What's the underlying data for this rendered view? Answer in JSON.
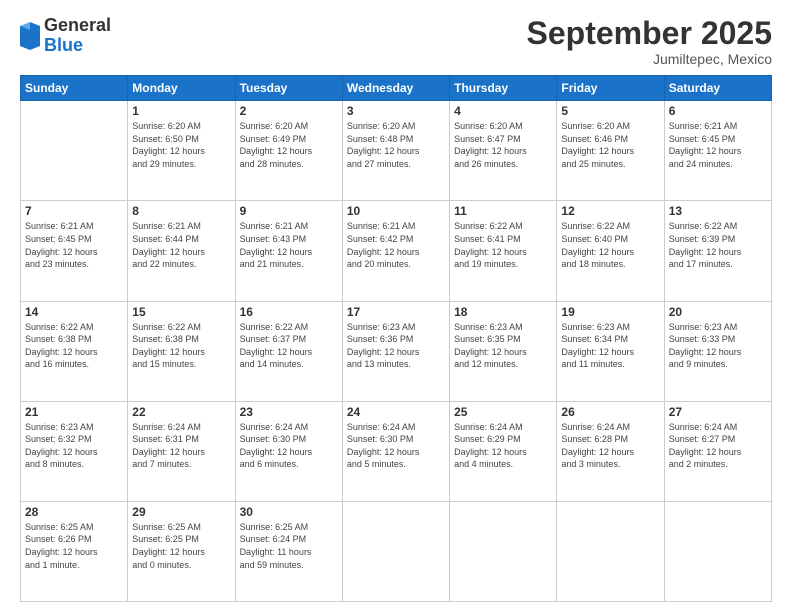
{
  "logo": {
    "general": "General",
    "blue": "Blue"
  },
  "header": {
    "month": "September 2025",
    "location": "Jumiltepec, Mexico"
  },
  "weekdays": [
    "Sunday",
    "Monday",
    "Tuesday",
    "Wednesday",
    "Thursday",
    "Friday",
    "Saturday"
  ],
  "weeks": [
    [
      {
        "day": "",
        "info": ""
      },
      {
        "day": "1",
        "info": "Sunrise: 6:20 AM\nSunset: 6:50 PM\nDaylight: 12 hours\nand 29 minutes."
      },
      {
        "day": "2",
        "info": "Sunrise: 6:20 AM\nSunset: 6:49 PM\nDaylight: 12 hours\nand 28 minutes."
      },
      {
        "day": "3",
        "info": "Sunrise: 6:20 AM\nSunset: 6:48 PM\nDaylight: 12 hours\nand 27 minutes."
      },
      {
        "day": "4",
        "info": "Sunrise: 6:20 AM\nSunset: 6:47 PM\nDaylight: 12 hours\nand 26 minutes."
      },
      {
        "day": "5",
        "info": "Sunrise: 6:20 AM\nSunset: 6:46 PM\nDaylight: 12 hours\nand 25 minutes."
      },
      {
        "day": "6",
        "info": "Sunrise: 6:21 AM\nSunset: 6:45 PM\nDaylight: 12 hours\nand 24 minutes."
      }
    ],
    [
      {
        "day": "7",
        "info": "Sunrise: 6:21 AM\nSunset: 6:45 PM\nDaylight: 12 hours\nand 23 minutes."
      },
      {
        "day": "8",
        "info": "Sunrise: 6:21 AM\nSunset: 6:44 PM\nDaylight: 12 hours\nand 22 minutes."
      },
      {
        "day": "9",
        "info": "Sunrise: 6:21 AM\nSunset: 6:43 PM\nDaylight: 12 hours\nand 21 minutes."
      },
      {
        "day": "10",
        "info": "Sunrise: 6:21 AM\nSunset: 6:42 PM\nDaylight: 12 hours\nand 20 minutes."
      },
      {
        "day": "11",
        "info": "Sunrise: 6:22 AM\nSunset: 6:41 PM\nDaylight: 12 hours\nand 19 minutes."
      },
      {
        "day": "12",
        "info": "Sunrise: 6:22 AM\nSunset: 6:40 PM\nDaylight: 12 hours\nand 18 minutes."
      },
      {
        "day": "13",
        "info": "Sunrise: 6:22 AM\nSunset: 6:39 PM\nDaylight: 12 hours\nand 17 minutes."
      }
    ],
    [
      {
        "day": "14",
        "info": "Sunrise: 6:22 AM\nSunset: 6:38 PM\nDaylight: 12 hours\nand 16 minutes."
      },
      {
        "day": "15",
        "info": "Sunrise: 6:22 AM\nSunset: 6:38 PM\nDaylight: 12 hours\nand 15 minutes."
      },
      {
        "day": "16",
        "info": "Sunrise: 6:22 AM\nSunset: 6:37 PM\nDaylight: 12 hours\nand 14 minutes."
      },
      {
        "day": "17",
        "info": "Sunrise: 6:23 AM\nSunset: 6:36 PM\nDaylight: 12 hours\nand 13 minutes."
      },
      {
        "day": "18",
        "info": "Sunrise: 6:23 AM\nSunset: 6:35 PM\nDaylight: 12 hours\nand 12 minutes."
      },
      {
        "day": "19",
        "info": "Sunrise: 6:23 AM\nSunset: 6:34 PM\nDaylight: 12 hours\nand 11 minutes."
      },
      {
        "day": "20",
        "info": "Sunrise: 6:23 AM\nSunset: 6:33 PM\nDaylight: 12 hours\nand 9 minutes."
      }
    ],
    [
      {
        "day": "21",
        "info": "Sunrise: 6:23 AM\nSunset: 6:32 PM\nDaylight: 12 hours\nand 8 minutes."
      },
      {
        "day": "22",
        "info": "Sunrise: 6:24 AM\nSunset: 6:31 PM\nDaylight: 12 hours\nand 7 minutes."
      },
      {
        "day": "23",
        "info": "Sunrise: 6:24 AM\nSunset: 6:30 PM\nDaylight: 12 hours\nand 6 minutes."
      },
      {
        "day": "24",
        "info": "Sunrise: 6:24 AM\nSunset: 6:30 PM\nDaylight: 12 hours\nand 5 minutes."
      },
      {
        "day": "25",
        "info": "Sunrise: 6:24 AM\nSunset: 6:29 PM\nDaylight: 12 hours\nand 4 minutes."
      },
      {
        "day": "26",
        "info": "Sunrise: 6:24 AM\nSunset: 6:28 PM\nDaylight: 12 hours\nand 3 minutes."
      },
      {
        "day": "27",
        "info": "Sunrise: 6:24 AM\nSunset: 6:27 PM\nDaylight: 12 hours\nand 2 minutes."
      }
    ],
    [
      {
        "day": "28",
        "info": "Sunrise: 6:25 AM\nSunset: 6:26 PM\nDaylight: 12 hours\nand 1 minute."
      },
      {
        "day": "29",
        "info": "Sunrise: 6:25 AM\nSunset: 6:25 PM\nDaylight: 12 hours\nand 0 minutes."
      },
      {
        "day": "30",
        "info": "Sunrise: 6:25 AM\nSunset: 6:24 PM\nDaylight: 11 hours\nand 59 minutes."
      },
      {
        "day": "",
        "info": ""
      },
      {
        "day": "",
        "info": ""
      },
      {
        "day": "",
        "info": ""
      },
      {
        "day": "",
        "info": ""
      }
    ]
  ]
}
